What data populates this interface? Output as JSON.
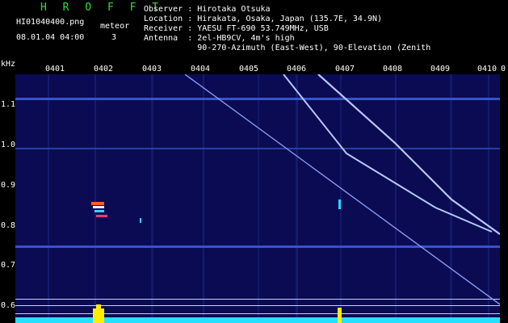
{
  "brand": "H R O F F T",
  "file_name": "HI01040400.png",
  "kind_label": "meteor",
  "date_time": "08.01.04 04:00",
  "meteor_count": "3",
  "station": {
    "observer_label": "Observer",
    "observer": "Hirotaka Otsuka",
    "location_label": "Location",
    "location": "Hirakata, Osaka, Japan (135.7E, 34.9N)",
    "receiver_label": "Receiver",
    "receiver": "YAESU FT-690 53.749MHz, USB",
    "antenna_label": "Antenna",
    "antenna_line1": "2el-HB9CV, 4m's high",
    "antenna_line2": "90-270-Azimuth (East-West), 90-Elevation (Zenith"
  },
  "y_axis_unit": "kHz",
  "x_ticks": [
    "0401",
    "0402",
    "0403",
    "0404",
    "0405",
    "0406",
    "0407",
    "0408",
    "0409",
    "0410"
  ],
  "x_tick_end": "0",
  "y_ticks": [
    "1.1",
    "1.0",
    "0.9",
    "0.8",
    "0.7",
    "0.6"
  ],
  "colors": {
    "background": "#000000",
    "plot_bg": "#0a0b52",
    "brand": "#33dd33",
    "grid": "#3a52c8",
    "signal": "#b8c8ff",
    "noise_floor": "#24e0ff",
    "burst": "#ffee00"
  }
}
